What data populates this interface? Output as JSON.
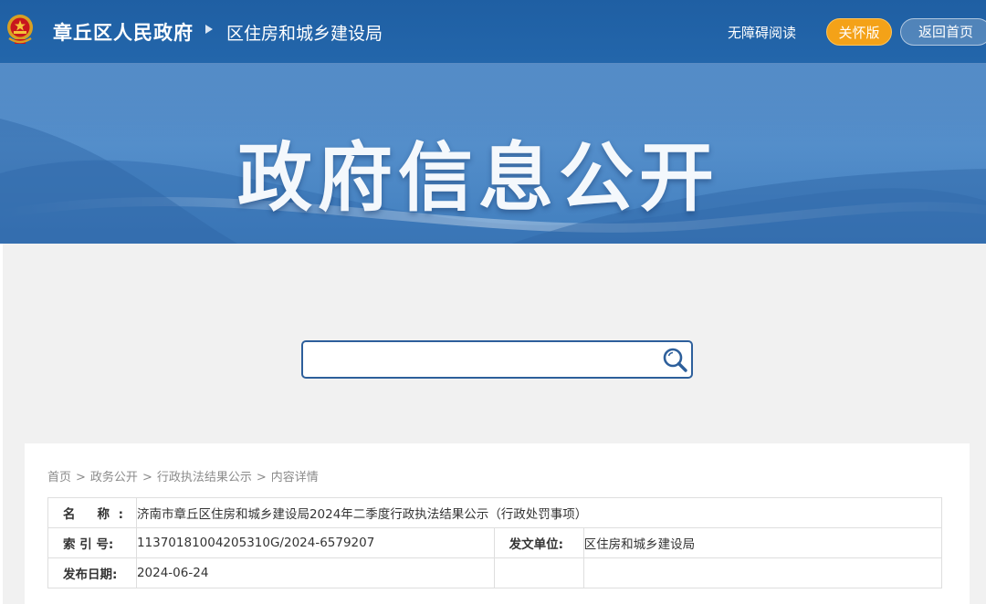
{
  "header": {
    "site_title": "章丘区人民政府",
    "department": "区住房和城乡建设局",
    "accessibility_link": "无障碍阅读",
    "elder_mode_button": "关怀版",
    "home_button": "返回首页",
    "emblem_icon": "national-emblem-icon"
  },
  "banner": {
    "title": "政府信息公开"
  },
  "search": {
    "placeholder": "",
    "value": "",
    "icon": "search-icon"
  },
  "breadcrumb": {
    "items": [
      "首页",
      "政务公开",
      "行政执法结果公示",
      "内容详情"
    ],
    "separator": ">"
  },
  "document": {
    "name_label": "名 称:",
    "name_value": "济南市章丘区住房和城乡建设局2024年二季度行政执法结果公示（行政处罚事项）",
    "index_label": "索 引 号:",
    "index_value": "11370181004205310G/2024-6579207",
    "issuer_label": "发文单位:",
    "issuer_value": "区住房和城乡建设局",
    "date_label": "发布日期:",
    "date_value": "2024-06-24"
  },
  "colors": {
    "header_blue": "#2366ab",
    "banner_blue": "#4a86c5",
    "elder_orange": "#f4a218",
    "search_border": "#2d5f9b"
  }
}
